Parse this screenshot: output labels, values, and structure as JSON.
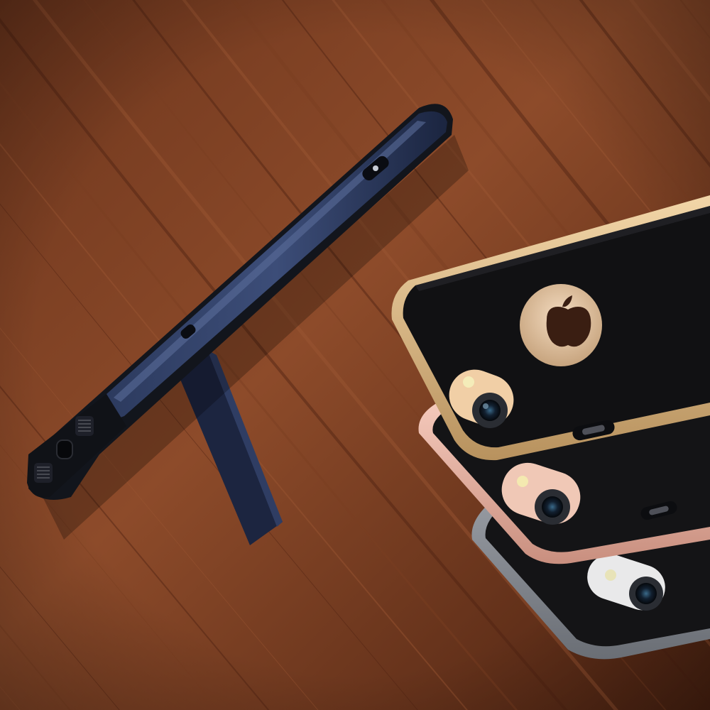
{
  "scene": {
    "subject": "phone-case-product-photo",
    "colors": {
      "wood_light": "#9b5633",
      "wood_mid": "#7a3d22",
      "wood_dark": "#4e2212",
      "navy_case": "#1f2a44",
      "navy_highlight": "#3a4a72",
      "case_black": "#141416",
      "gold_bumper": "#d7b485",
      "rose_bumper": "#e9b8a8",
      "gray_bumper": "#8a8e95",
      "camera_ring": "#f0c9b0"
    },
    "cases": [
      {
        "name": "navy-kickstand-case",
        "bumper_color": "#1f2a44"
      },
      {
        "name": "gold-bumper-case",
        "bumper_color": "#d7b485"
      },
      {
        "name": "rose-gold-bumper-case",
        "bumper_color": "#e9b8a8"
      },
      {
        "name": "space-gray-bumper-case",
        "bumper_color": "#8a8e95"
      }
    ]
  }
}
